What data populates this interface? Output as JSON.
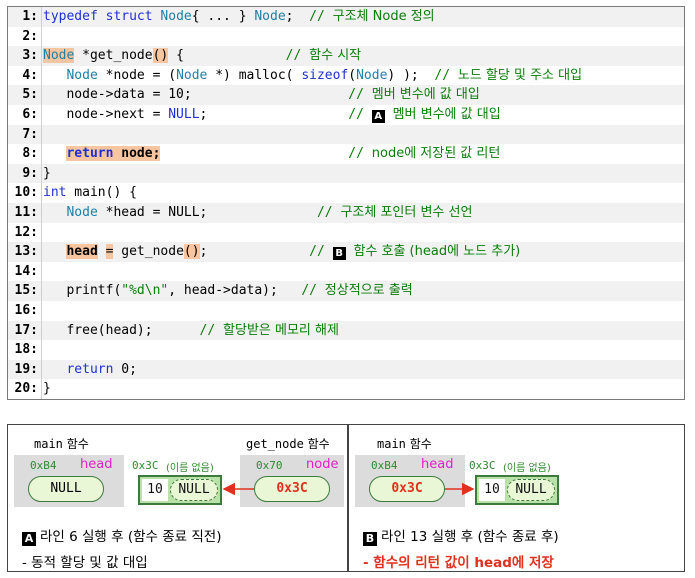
{
  "code": {
    "lines": [
      {
        "n": "1:",
        "html": "<span class=\"kw\">typedef</span> <span class=\"kw\">struct</span> <span class=\"ty\">Node</span>{ ... } <span class=\"ty\">Node</span>;  <span class=\"cm\">// <span class=\"cm-ko\">구조체 Node 정의</span></span>"
      },
      {
        "n": "2:",
        "html": ""
      },
      {
        "n": "3:",
        "html": "<span class=\"ty hl\">Node</span> *get_node<span class=\"hl\">()</span> {             <span class=\"cm\">// <span class=\"cm-ko\">함수 시작</span></span>"
      },
      {
        "n": "4:",
        "html": "   <span class=\"ty\">Node</span> *node = (<span class=\"ty\">Node</span> *) malloc( <span class=\"kw\">sizeof</span>(<span class=\"ty\">Node</span>) );  <span class=\"cm\">// <span class=\"cm-ko\">노드 할당 및 주소 대입</span></span>"
      },
      {
        "n": "5:",
        "html": "   node-&gt;data = 10;                    <span class=\"cm\">// <span class=\"cm-ko\">멤버 변수에 값 대입</span></span>"
      },
      {
        "n": "6:",
        "html": "   node-&gt;next = <span class=\"kw\">NULL</span>;                  <span class=\"cm\">// <span class=\"mark\">A</span> <span class=\"cm-ko\">멤버 변수에 값 대입</span></span>"
      },
      {
        "n": "7:",
        "html": ""
      },
      {
        "n": "8:",
        "html": "   <span class=\"hlb\"><span class=\"kwb\">return</span> node;</span>                        <span class=\"cm\">// <span class=\"cm-ko\">node에 저장된 값 리턴</span></span>"
      },
      {
        "n": "9:",
        "html": "}"
      },
      {
        "n": "10:",
        "html": "<span class=\"kw\">int</span> main() {"
      },
      {
        "n": "11:",
        "html": "   <span class=\"ty\">Node</span> *head = NULL;              <span class=\"cm\">// <span class=\"cm-ko\">구조체 포인터 변수 선언</span></span>"
      },
      {
        "n": "12:",
        "html": ""
      },
      {
        "n": "13:",
        "html": "   <span class=\"hlb\">head</span> <span class=\"hl\">=</span> get_node<span class=\"hl\">()</span>;             <span class=\"cm\">// <span class=\"mark\">B</span> <span class=\"cm-ko\">함수 호출 (head에 노드 추가)</span></span>"
      },
      {
        "n": "14:",
        "html": ""
      },
      {
        "n": "15:",
        "html": "   printf(<span class=\"cm\">\"%d\\n\"</span>, head-&gt;data);   <span class=\"cm\">// <span class=\"cm-ko\">정상적으로 출력</span></span>"
      },
      {
        "n": "16:",
        "html": ""
      },
      {
        "n": "17:",
        "html": "   free(head);      <span class=\"cm\">// <span class=\"cm-ko\">할당받은 메모리 해제</span></span>"
      },
      {
        "n": "18:",
        "html": ""
      },
      {
        "n": "19:",
        "html": "   <span class=\"kw\">return</span> 0;"
      },
      {
        "n": "20:",
        "html": "}"
      }
    ]
  },
  "diagram_a": {
    "main_label_func": "main",
    "main_label_ko": " 함수",
    "getnode_label_func": "get_node",
    "getnode_label_ko": " 함수",
    "main_addr": "0xB4",
    "main_var": "head",
    "main_value": "NULL",
    "heap_addr": "0x3C",
    "heap_noname": "(이름 없음)",
    "heap_data": "10",
    "heap_next": "NULL",
    "getnode_addr": "0x70",
    "getnode_var": "node",
    "getnode_value": "0x3C",
    "caption_mark": "A",
    "caption": "라인 6 실행 후 (함수 종료 직전)",
    "note": "- 동적 할당 및 값 대입"
  },
  "diagram_b": {
    "main_label_func": "main",
    "main_label_ko": " 함수",
    "main_addr": "0xB4",
    "main_var": "head",
    "main_value": "0x3C",
    "heap_addr": "0x3C",
    "heap_noname": "(이름 없음)",
    "heap_data": "10",
    "heap_next": "NULL",
    "caption_mark": "B",
    "caption": "라인 13 실행 후 (함수 종료 후)",
    "note": "- 함수의 리턴 값이 head에 저장"
  },
  "colors": {
    "keyword": "#1f2fd1",
    "type": "#1f7fa6",
    "comment": "#0a7d0a",
    "highlight": "#f7c6a0",
    "var_name": "#e020c8",
    "address": "#2e8b2e",
    "arrow": "#e0301e"
  }
}
